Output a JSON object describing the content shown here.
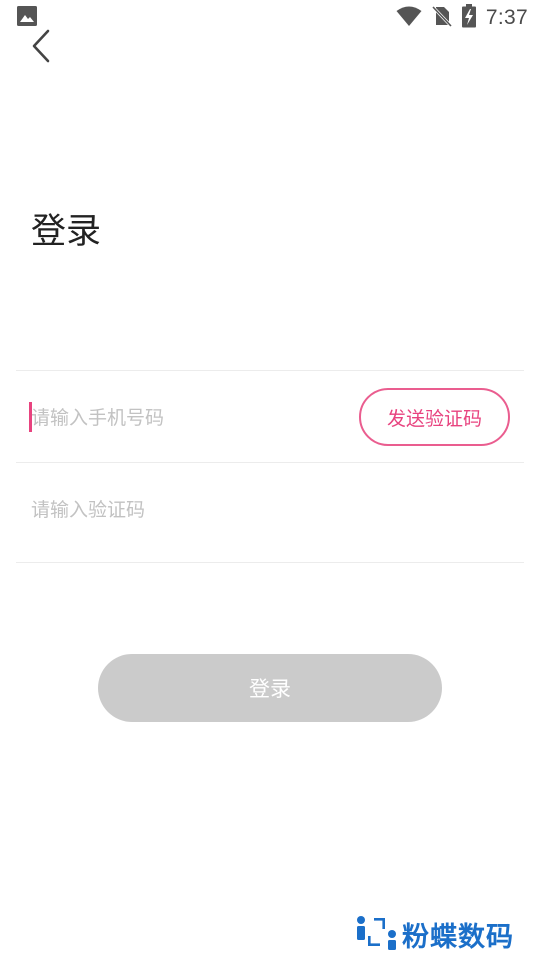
{
  "status_bar": {
    "time": "7:37",
    "icons": [
      "image-notification-icon",
      "wifi-icon",
      "no-sim-icon",
      "battery-charging-icon"
    ]
  },
  "header": {
    "back_icon": "chevron-left-icon"
  },
  "login": {
    "title": "登录",
    "phone_placeholder": "请输入手机号码",
    "code_placeholder": "请输入验证码",
    "send_code_label": "发送验证码",
    "submit_label": "登录"
  },
  "watermark": {
    "text": "粉蝶数码",
    "icon": "fendie-logo-icon"
  },
  "colors": {
    "accent": "#e8437f",
    "button_disabled": "#cbcbcb",
    "watermark_blue": "#1b6fc9"
  }
}
